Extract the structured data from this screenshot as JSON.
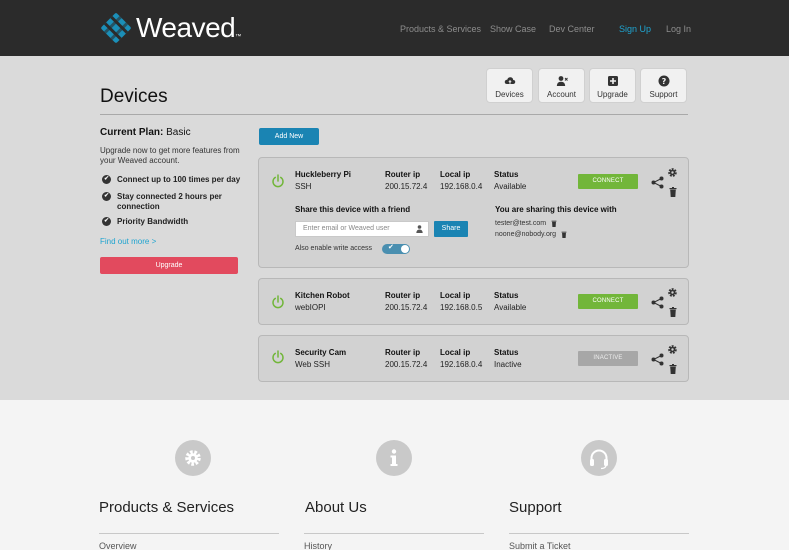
{
  "header": {
    "logo_text": "Weaved",
    "logo_tm": "™",
    "nav": [
      "Products & Services",
      "Show Case",
      "Dev Center",
      "Sign Up",
      "Log In"
    ]
  },
  "page": {
    "title": "Devices",
    "toolbar": [
      "Devices",
      "Account",
      "Upgrade",
      "Support"
    ]
  },
  "plan": {
    "label": "Current Plan:",
    "value": "Basic",
    "description": "Upgrade now to get more features from your Weaved account.",
    "features": [
      "Connect up to 100 times per day",
      "Stay connected 2 hours per connection",
      "Priority Bandwidth"
    ],
    "find_out_more": "Find out more >",
    "upgrade_label": "Upgrade"
  },
  "add_new_label": "Add New",
  "column_headers": {
    "router": "Router ip",
    "local": "Local ip",
    "status": "Status"
  },
  "devices": [
    {
      "name": "Huckleberry Pi",
      "service": "SSH",
      "router_ip": "200.15.72.4",
      "local_ip": "192.168.0.4",
      "status": "Available",
      "button": "CONNECT"
    },
    {
      "name": "Kitchen Robot",
      "service": "webIOPI",
      "router_ip": "200.15.72.4",
      "local_ip": "192.168.0.5",
      "status": "Available",
      "button": "CONNECT"
    },
    {
      "name": "Security Cam",
      "service": "Web SSH",
      "router_ip": "200.15.72.4",
      "local_ip": "192.168.0.4",
      "status": "Inactive",
      "button": "INACTIVE"
    }
  ],
  "sharing": {
    "title": "Share this device with a friend",
    "placeholder": "Enter email or Weaved user",
    "share_label": "Share",
    "write_label": "Also enable write access",
    "write_enabled": true,
    "shared_title": "You are sharing this device with",
    "shared_with": [
      "tester@test.com",
      "noone@nobody.org"
    ]
  },
  "footer": {
    "columns": [
      {
        "title": "Products & Services",
        "link": "Overview",
        "icon": "gear-icon"
      },
      {
        "title": "About Us",
        "link": "History",
        "icon": "info-icon"
      },
      {
        "title": "Support",
        "link": "Submit a Ticket",
        "icon": "headset-icon"
      }
    ]
  },
  "colors": {
    "header_bg": "#2b2b2b",
    "accent_blue": "#1fa4d0",
    "connect_green": "#72b63a",
    "upgrade_red": "#e24a5e",
    "logo_teal": "#1b8fb8"
  }
}
